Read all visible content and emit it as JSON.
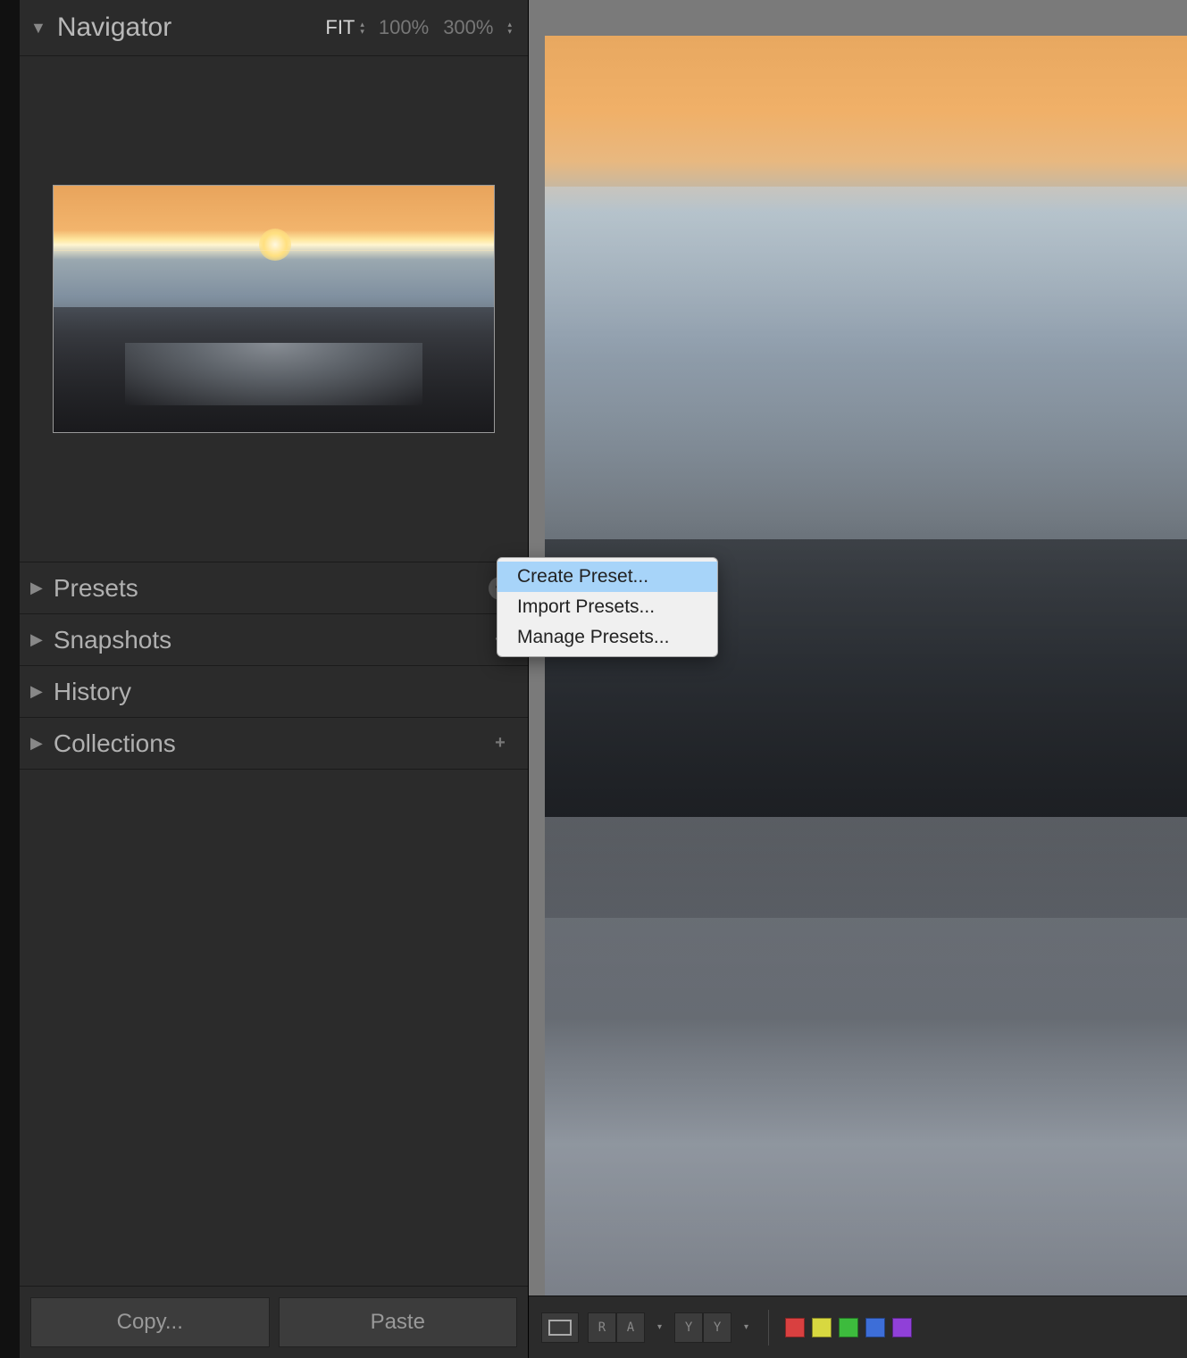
{
  "navigator": {
    "title": "Navigator",
    "zoom": {
      "fit": "FIT",
      "z100": "100%",
      "z300": "300%"
    }
  },
  "panels": {
    "presets": "Presets",
    "snapshots": "Snapshots",
    "history": "History",
    "collections": "Collections"
  },
  "buttons": {
    "copy": "Copy...",
    "paste": "Paste"
  },
  "menu": {
    "create": "Create Preset...",
    "import": "Import Presets...",
    "manage": "Manage Presets..."
  },
  "toolbar": {
    "segR": "R",
    "segA": "A",
    "segY1": "Y",
    "segY2": "Y"
  },
  "colors": {
    "red": "#d94040",
    "yellow": "#d8d840",
    "green": "#3dbb3d",
    "blue": "#3d6ed8",
    "purple": "#9040d8"
  }
}
